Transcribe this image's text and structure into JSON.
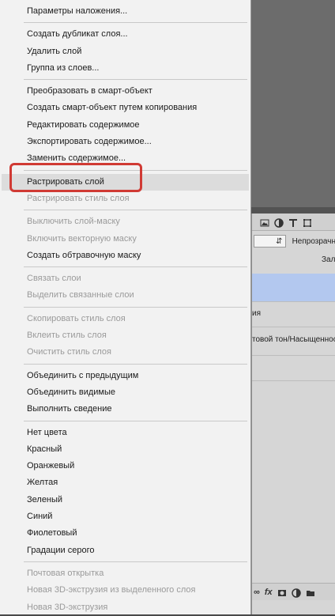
{
  "context_menu": {
    "groups": [
      [
        {
          "label": "Параметры наложения...",
          "disabled": false
        }
      ],
      [
        {
          "label": "Создать дубликат слоя...",
          "disabled": false
        },
        {
          "label": "Удалить слой",
          "disabled": false
        },
        {
          "label": "Группа из слоев...",
          "disabled": false
        }
      ],
      [
        {
          "label": "Преобразовать в смарт-объект",
          "disabled": false
        },
        {
          "label": "Создать смарт-объект путем копирования",
          "disabled": false
        },
        {
          "label": "Редактировать содержимое",
          "disabled": false
        },
        {
          "label": "Экспортировать содержимое...",
          "disabled": false
        },
        {
          "label": "Заменить содержимое...",
          "disabled": false
        }
      ],
      [
        {
          "label": "Растрировать слой",
          "disabled": false,
          "hovered": true
        },
        {
          "label": "Растрировать стиль слоя",
          "disabled": true
        }
      ],
      [
        {
          "label": "Выключить слой-маску",
          "disabled": true
        },
        {
          "label": "Включить векторную маску",
          "disabled": true
        },
        {
          "label": "Создать обтравочную маску",
          "disabled": false
        }
      ],
      [
        {
          "label": "Связать слои",
          "disabled": true
        },
        {
          "label": "Выделить связанные слои",
          "disabled": true
        }
      ],
      [
        {
          "label": "Скопировать стиль слоя",
          "disabled": true
        },
        {
          "label": "Вклеить стиль слоя",
          "disabled": true
        },
        {
          "label": "Очистить стиль слоя",
          "disabled": true
        }
      ],
      [
        {
          "label": "Объединить с предыдущим",
          "disabled": false
        },
        {
          "label": "Объединить видимые",
          "disabled": false
        },
        {
          "label": "Выполнить сведение",
          "disabled": false
        }
      ],
      [
        {
          "label": "Нет цвета",
          "disabled": false
        },
        {
          "label": "Красный",
          "disabled": false
        },
        {
          "label": "Оранжевый",
          "disabled": false
        },
        {
          "label": "Желтая",
          "disabled": false
        },
        {
          "label": "Зеленый",
          "disabled": false
        },
        {
          "label": "Синий",
          "disabled": false
        },
        {
          "label": "Фиолетовый",
          "disabled": false
        },
        {
          "label": "Градации серого",
          "disabled": false
        }
      ],
      [
        {
          "label": "Почтовая открытка",
          "disabled": true
        },
        {
          "label": "Новая 3D-экструзия из выделенного слоя",
          "disabled": true
        },
        {
          "label": "Новая 3D-экструзия",
          "disabled": true
        }
      ]
    ]
  },
  "layers_panel": {
    "opacity_label": "Непрозрачн",
    "fill_label": "Зал",
    "layer_texts": [
      "ия",
      "товой тон/Насыщенность"
    ],
    "footer_fx": "fx"
  },
  "highlight_color": "#d03a34"
}
